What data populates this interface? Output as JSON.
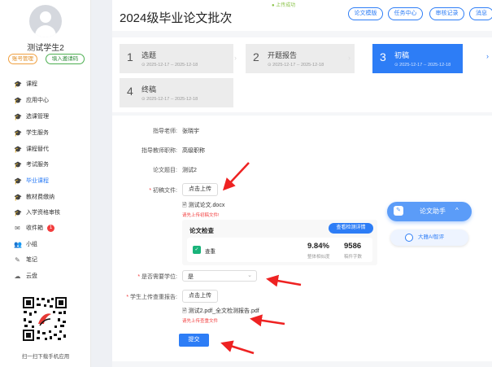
{
  "sidebar": {
    "username": "测试学生2",
    "account_btn": "账号管理",
    "invite_btn": "填入邀请码",
    "menu": [
      {
        "label": "课程",
        "icon": "graduation-cap-icon"
      },
      {
        "label": "应用中心",
        "icon": "graduation-cap-icon"
      },
      {
        "label": "选课管理",
        "icon": "graduation-cap-icon"
      },
      {
        "label": "学生服务",
        "icon": "graduation-cap-icon"
      },
      {
        "label": "课程替代",
        "icon": "graduation-cap-icon"
      },
      {
        "label": "考试服务",
        "icon": "graduation-cap-icon"
      },
      {
        "label": "毕业课程",
        "icon": "graduation-cap-icon",
        "active": true
      },
      {
        "label": "教材费缴纳",
        "icon": "graduation-cap-icon"
      },
      {
        "label": "入学资格审核",
        "icon": "graduation-cap-icon"
      },
      {
        "label": "收件箱",
        "icon": "mail-icon",
        "badge": "1"
      },
      {
        "label": "小组",
        "icon": "group-icon"
      },
      {
        "label": "笔记",
        "icon": "note-icon"
      },
      {
        "label": "云盘",
        "icon": "cloud-icon"
      }
    ],
    "qr_caption": "扫一扫下载手机应用"
  },
  "header": {
    "title": "2024级毕业论文批次",
    "upload_status": "上传成功",
    "buttons": [
      "论文模版",
      "任务中心",
      "审核记录",
      "消息"
    ]
  },
  "stages": [
    {
      "num": "1",
      "name": "选题",
      "date": "2025-12-17 -- 2025-12-18",
      "active": false
    },
    {
      "num": "2",
      "name": "开题报告",
      "date": "2025-12-17 -- 2025-12-18",
      "active": false
    },
    {
      "num": "3",
      "name": "初稿",
      "date": "2025-12-17 -- 2025-12-18",
      "active": true
    },
    {
      "num": "4",
      "name": "终稿",
      "date": "2025-12-17 -- 2025-12-18",
      "active": false
    }
  ],
  "form": {
    "advisor_label": "指导老师:",
    "advisor_value": "张晓宇",
    "title_label": "指导教师职称:",
    "title_value": "高级职称",
    "topic_label": "论文题目:",
    "topic_value": "测试2",
    "draft_label": "初稿文件:",
    "upload_btn": "点击上传",
    "draft_file": "测试论文.docx",
    "draft_hint": "请先上传初稿文件!",
    "check_title": "论文检查",
    "check_btn": "查看检测详情",
    "check_name": "查重",
    "similarity_value": "9.84%",
    "similarity_label": "整体相似度",
    "word_count_value": "9586",
    "word_count_label": "稿件字数",
    "degree_label": "是否需要学位:",
    "degree_value": "是",
    "report_label": "学生上传查重报告:",
    "report_btn": "点击上传",
    "report_file": "测试2.pdf_全文检测报告.pdf",
    "report_hint": "请先上传查重文件",
    "submit": "提交"
  },
  "assistant": {
    "label": "论文助手",
    "ai_review": "大雅AI智评"
  },
  "colors": {
    "accent": "#2d7df6",
    "error": "#f23c3c",
    "annotation_arrow": "#ee2222"
  }
}
